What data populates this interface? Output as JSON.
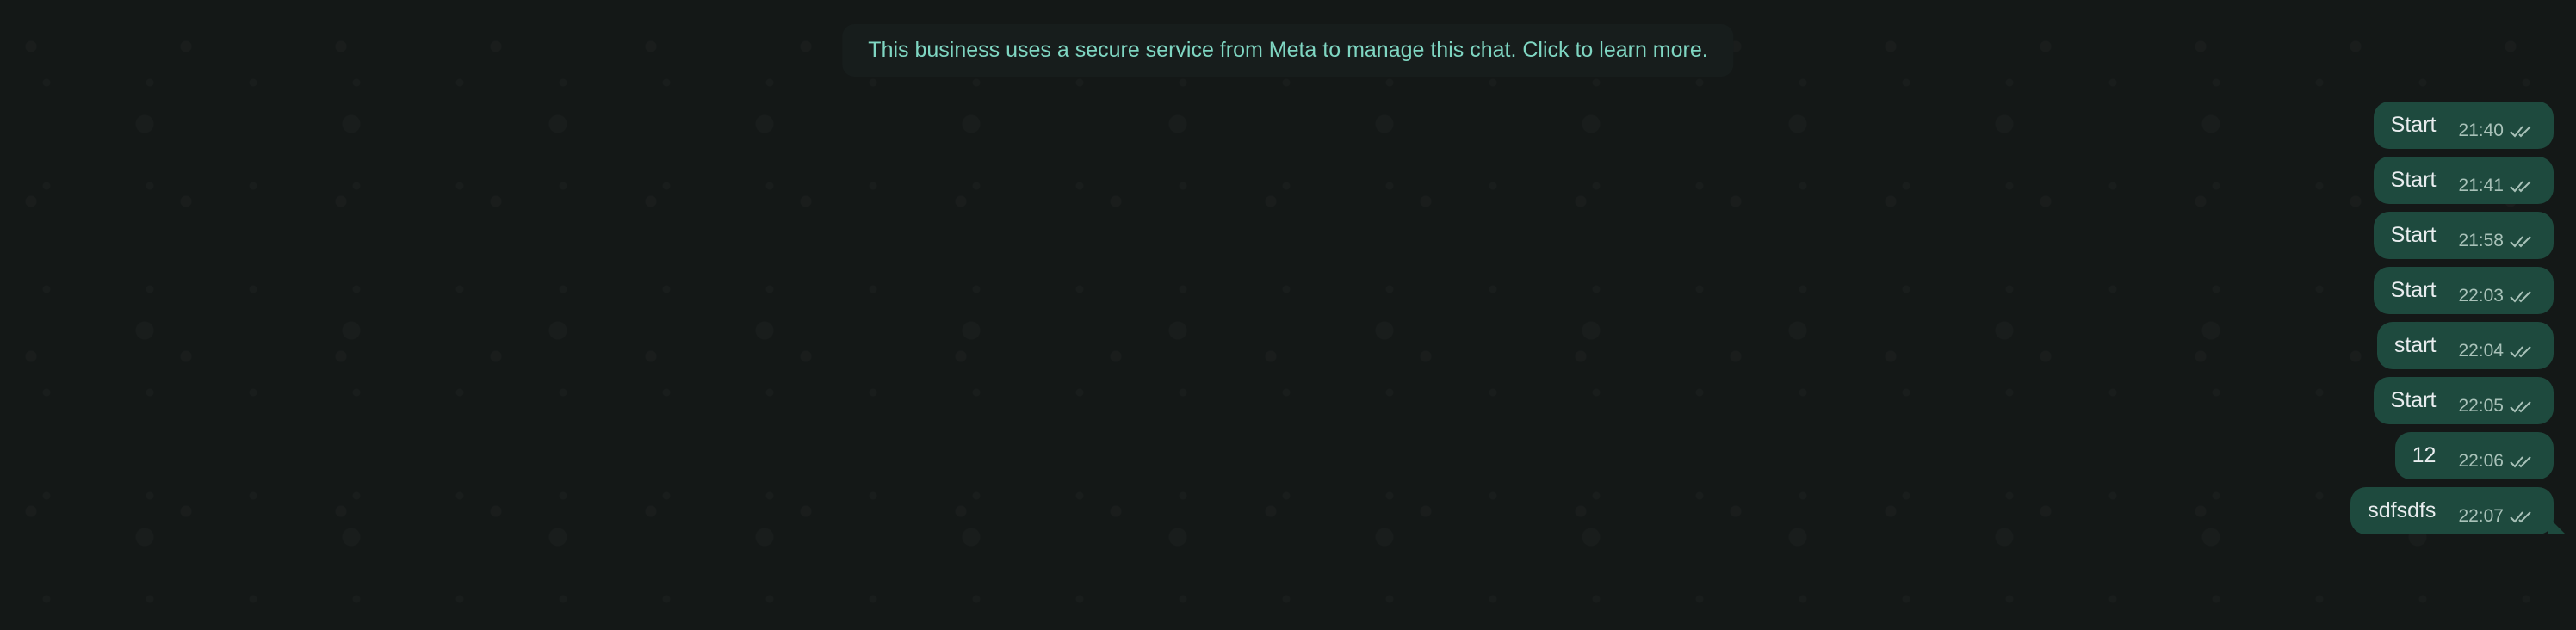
{
  "banner": {
    "text": "This business uses a secure service from Meta to manage this chat. Click to learn more."
  },
  "messages": [
    {
      "text": "Start",
      "time": "21:40",
      "status_icon": "double-check-icon"
    },
    {
      "text": "Start",
      "time": "21:41",
      "status_icon": "double-check-icon"
    },
    {
      "text": "Start",
      "time": "21:58",
      "status_icon": "double-check-icon"
    },
    {
      "text": "Start",
      "time": "22:03",
      "status_icon": "double-check-icon"
    },
    {
      "text": "start",
      "time": "22:04",
      "status_icon": "double-check-icon"
    },
    {
      "text": "Start",
      "time": "22:05",
      "status_icon": "double-check-icon"
    },
    {
      "text": "12",
      "time": "22:06",
      "status_icon": "double-check-icon"
    },
    {
      "text": "sdfsdfs",
      "time": "22:07",
      "status_icon": "double-check-icon"
    }
  ],
  "colors": {
    "background": "#111615",
    "bubble": "#1e4a3e",
    "banner_text": "#7fd6c2",
    "message_text": "#e9edef",
    "meta_text": "#a9c2b9"
  }
}
